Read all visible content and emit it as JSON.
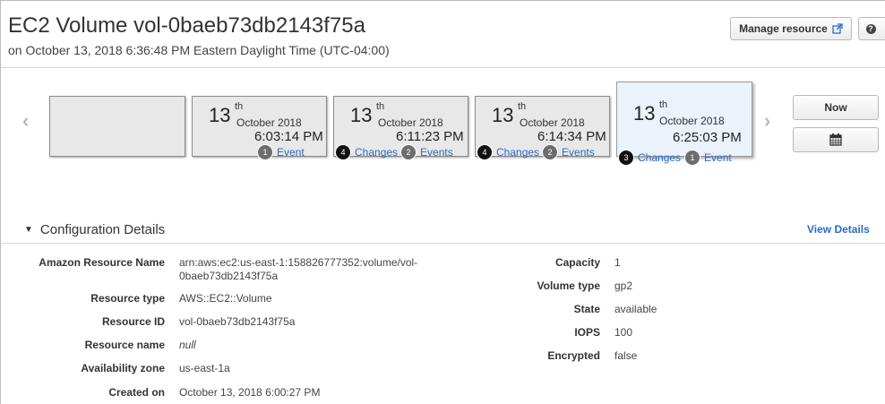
{
  "header": {
    "title": "EC2 Volume vol-0baeb73db2143f75a",
    "subtitle": "on October 13, 2018 6:36:48 PM Eastern Daylight Time (UTC-04:00)",
    "manage_label": "Manage resource",
    "help_label": "?"
  },
  "timeline": {
    "prev_label": "‹",
    "next_label": "›",
    "now_label": "Now",
    "calendar_icon": "calendar-icon",
    "cards": [
      {
        "day": "13",
        "sup": "th",
        "month": "October 2018",
        "time": "6:03:14 PM",
        "changes_count": "",
        "changes_label": "",
        "events_count": "1",
        "events_label": "Event"
      },
      {
        "day": "13",
        "sup": "th",
        "month": "October 2018",
        "time": "6:11:23 PM",
        "changes_count": "4",
        "changes_label": "Changes",
        "events_count": "2",
        "events_label": "Events"
      },
      {
        "day": "13",
        "sup": "th",
        "month": "October 2018",
        "time": "6:14:34 PM",
        "changes_count": "4",
        "changes_label": "Changes",
        "events_count": "2",
        "events_label": "Events"
      },
      {
        "day": "13",
        "sup": "th",
        "month": "October 2018",
        "time": "6:25:03 PM",
        "changes_count": "3",
        "changes_label": "Changes",
        "events_count": "1",
        "events_label": "Event"
      }
    ]
  },
  "config": {
    "title": "Configuration Details",
    "view_details": "View Details",
    "left": [
      {
        "label": "Amazon Resource Name",
        "value_line1": "arn:aws:ec2:us-east-1:158826777352:volume/vol-",
        "value_line2": "0baeb73db2143f75a"
      },
      {
        "label": "Resource type",
        "value": "AWS::EC2::Volume"
      },
      {
        "label": "Resource ID",
        "value": "vol-0baeb73db2143f75a"
      },
      {
        "label": "Resource name",
        "value": "null"
      },
      {
        "label": "Availability zone",
        "value": "us-east-1a"
      },
      {
        "label": "Created on",
        "value": "October 13, 2018 6:00:27 PM"
      }
    ],
    "right": [
      {
        "label": "Capacity",
        "value": "1"
      },
      {
        "label": "Volume type",
        "value": "gp2"
      },
      {
        "label": "State",
        "value": "available"
      },
      {
        "label": "IOPS",
        "value": "100"
      },
      {
        "label": "Encrypted",
        "value": "false"
      }
    ]
  },
  "colors": {
    "link": "#2a6cc4",
    "current_card_bg": "#eaf2fb",
    "card_bg": "#e8e8e8"
  }
}
